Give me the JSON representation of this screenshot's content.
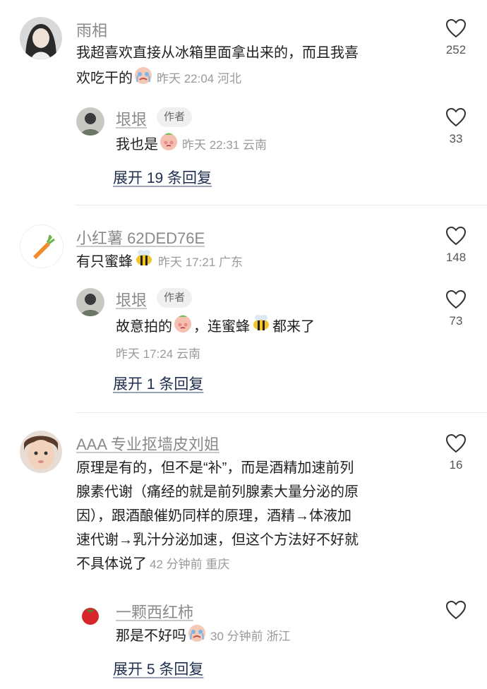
{
  "comments": [
    {
      "username": "雨相",
      "text": "我超喜欢直接从冰箱里面拿出来的，而且我喜",
      "text_line2": "欢吃干的",
      "emoji": "crying-face-emoji",
      "meta": "昨天 22:04 河北",
      "likes": "252",
      "reply": {
        "username": "垠垠",
        "badge": "作者",
        "text": "我也是",
        "emoji": "shy-face-emoji",
        "meta": "昨天 22:31 云南",
        "likes": "33"
      },
      "expand_label": "展开 19 条回复"
    },
    {
      "username": "小红薯 62DED76E",
      "text": "有只蜜蜂",
      "emoji": "bee-emoji",
      "meta": "昨天 17:21 广东",
      "likes": "148",
      "reply": {
        "username": "垠垠",
        "badge": "作者",
        "text_a": "故意拍的",
        "text_b": "，连蜜蜂",
        "text_c": "都来了",
        "meta": "昨天 17:24 云南",
        "likes": "73"
      },
      "expand_label": "展开 1 条回复"
    },
    {
      "username": "AAA 专业抠墙皮刘姐",
      "lines": [
        "原理是有的，但不是“补”，而是酒精加速前列",
        "腺素代谢（痛经的就是前列腺素大量分泌的原",
        "因），跟酒酿催奶同样的原理，酒精→体液加",
        "速代谢→乳汁分泌加速，但这个方法好不好就",
        "不具体说了"
      ],
      "meta": "42 分钟前 重庆",
      "likes": "16",
      "reply": {
        "username": "一颗西红柿",
        "text": "那是不好吗",
        "emoji": "crying-face-emoji",
        "meta": "30 分钟前 浙江",
        "likes": ""
      },
      "expand_label": "展开 5 条回复"
    }
  ]
}
